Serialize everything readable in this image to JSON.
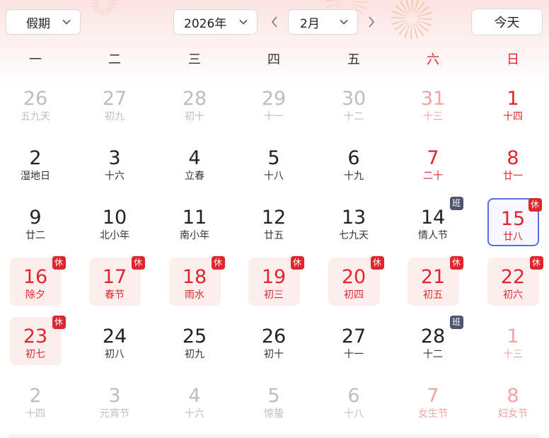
{
  "toolbar": {
    "holiday_label": "假期",
    "year_label": "2026年",
    "month_label": "2月",
    "today_label": "今天"
  },
  "colors": {
    "accent_red": "#e0262d",
    "work_badge": "#4d5570",
    "today_border": "#5a6fe0",
    "rest_bg": "#fdeeee"
  },
  "weekdays": [
    {
      "label": "一",
      "weekend": false
    },
    {
      "label": "二",
      "weekend": false
    },
    {
      "label": "三",
      "weekend": false
    },
    {
      "label": "四",
      "weekend": false
    },
    {
      "label": "五",
      "weekend": false
    },
    {
      "label": "六",
      "weekend": true
    },
    {
      "label": "日",
      "weekend": true
    }
  ],
  "weeks": [
    [
      {
        "day": "26",
        "lunar": "五九天",
        "other": true
      },
      {
        "day": "27",
        "lunar": "初九",
        "other": true
      },
      {
        "day": "28",
        "lunar": "初十",
        "other": true
      },
      {
        "day": "29",
        "lunar": "十一",
        "other": true
      },
      {
        "day": "30",
        "lunar": "十二",
        "other": true
      },
      {
        "day": "31",
        "lunar": "十三",
        "other": true,
        "red": true
      },
      {
        "day": "1",
        "lunar": "十四",
        "red": true
      }
    ],
    [
      {
        "day": "2",
        "lunar": "湿地日"
      },
      {
        "day": "3",
        "lunar": "十六"
      },
      {
        "day": "4",
        "lunar": "立春"
      },
      {
        "day": "5",
        "lunar": "十八"
      },
      {
        "day": "6",
        "lunar": "十九"
      },
      {
        "day": "7",
        "lunar": "二十",
        "red": true
      },
      {
        "day": "8",
        "lunar": "廿一",
        "red": true
      }
    ],
    [
      {
        "day": "9",
        "lunar": "廿二"
      },
      {
        "day": "10",
        "lunar": "北小年"
      },
      {
        "day": "11",
        "lunar": "南小年"
      },
      {
        "day": "12",
        "lunar": "廿五"
      },
      {
        "day": "13",
        "lunar": "七九天"
      },
      {
        "day": "14",
        "lunar": "情人节",
        "badge": "班"
      },
      {
        "day": "15",
        "lunar": "廿八",
        "red": true,
        "today": true,
        "badge": "休"
      }
    ],
    [
      {
        "day": "16",
        "lunar": "除夕",
        "red": true,
        "rest": true,
        "badge": "休"
      },
      {
        "day": "17",
        "lunar": "春节",
        "red": true,
        "rest": true,
        "badge": "休"
      },
      {
        "day": "18",
        "lunar": "雨水",
        "red": true,
        "rest": true,
        "badge": "休"
      },
      {
        "day": "19",
        "lunar": "初三",
        "red": true,
        "rest": true,
        "badge": "休"
      },
      {
        "day": "20",
        "lunar": "初四",
        "red": true,
        "rest": true,
        "badge": "休"
      },
      {
        "day": "21",
        "lunar": "初五",
        "red": true,
        "rest": true,
        "badge": "休"
      },
      {
        "day": "22",
        "lunar": "初六",
        "red": true,
        "rest": true,
        "badge": "休"
      }
    ],
    [
      {
        "day": "23",
        "lunar": "初七",
        "red": true,
        "rest": true,
        "badge": "休"
      },
      {
        "day": "24",
        "lunar": "初八"
      },
      {
        "day": "25",
        "lunar": "初九"
      },
      {
        "day": "26",
        "lunar": "初十"
      },
      {
        "day": "27",
        "lunar": "十一"
      },
      {
        "day": "28",
        "lunar": "十二",
        "badge": "班"
      },
      {
        "day": "1",
        "lunar": "十三",
        "other": true,
        "red": true
      }
    ],
    [
      {
        "day": "2",
        "lunar": "十四",
        "other": true
      },
      {
        "day": "3",
        "lunar": "元宵节",
        "other": true
      },
      {
        "day": "4",
        "lunar": "十六",
        "other": true
      },
      {
        "day": "5",
        "lunar": "惊蛰",
        "other": true
      },
      {
        "day": "6",
        "lunar": "十八",
        "other": true
      },
      {
        "day": "7",
        "lunar": "女生节",
        "other": true,
        "red": true
      },
      {
        "day": "8",
        "lunar": "妇女节",
        "other": true,
        "red": true
      }
    ]
  ]
}
